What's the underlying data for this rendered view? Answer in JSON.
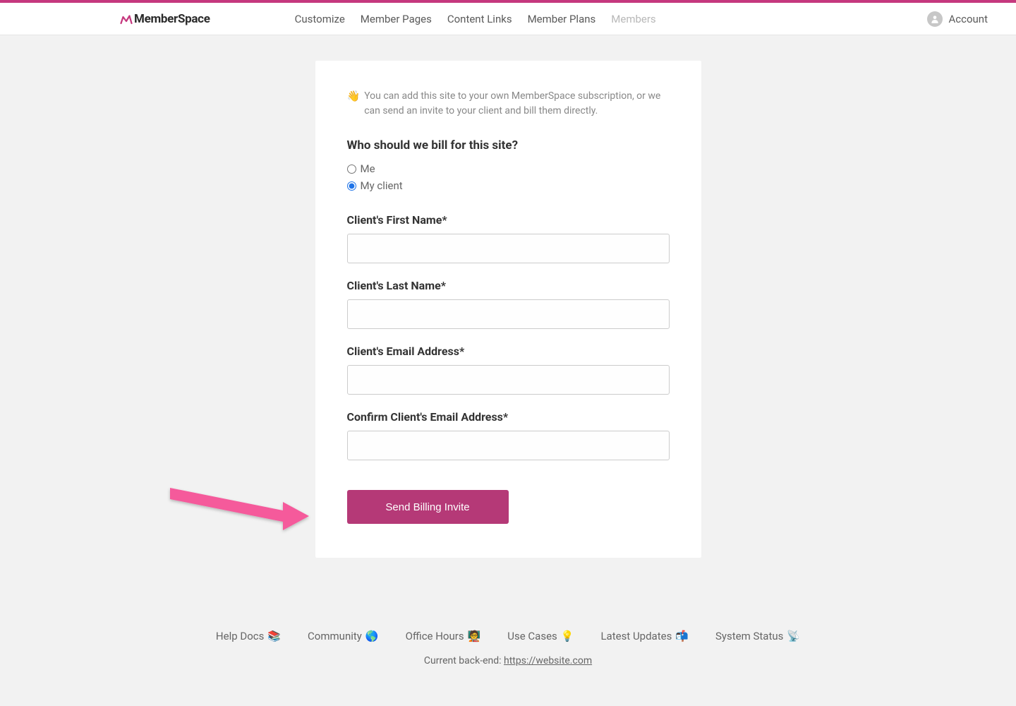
{
  "brand": {
    "name": "MemberSpace"
  },
  "nav": {
    "items": [
      {
        "label": "Customize"
      },
      {
        "label": "Member Pages"
      },
      {
        "label": "Content Links"
      },
      {
        "label": "Member Plans"
      },
      {
        "label": "Members"
      }
    ]
  },
  "account": {
    "label": "Account"
  },
  "card": {
    "wave_emoji": "👋",
    "intro_text": "You can add this site to your own MemberSpace subscription, or we can send an invite to your client and bill them directly.",
    "question": "Who should we bill for this site?",
    "options": {
      "me": "Me",
      "client": "My client"
    },
    "fields": {
      "first_name": "Client's First Name*",
      "last_name": "Client's Last Name*",
      "email": "Client's Email Address*",
      "confirm_email": "Confirm Client's Email Address*"
    },
    "submit": "Send Billing Invite"
  },
  "footer": {
    "links": [
      {
        "label": "Help Docs",
        "emoji": "📚"
      },
      {
        "label": "Community",
        "emoji": "🌎"
      },
      {
        "label": "Office Hours",
        "emoji": "🧑‍🏫"
      },
      {
        "label": "Use Cases",
        "emoji": "💡"
      },
      {
        "label": "Latest Updates",
        "emoji": "📬"
      },
      {
        "label": "System Status",
        "emoji": "📡"
      }
    ],
    "backend_prefix": "Current back-end: ",
    "backend_url": "https://website.com"
  },
  "colors": {
    "accent": "#c5387e",
    "button": "#b53977",
    "arrow": "#f55a9b"
  }
}
